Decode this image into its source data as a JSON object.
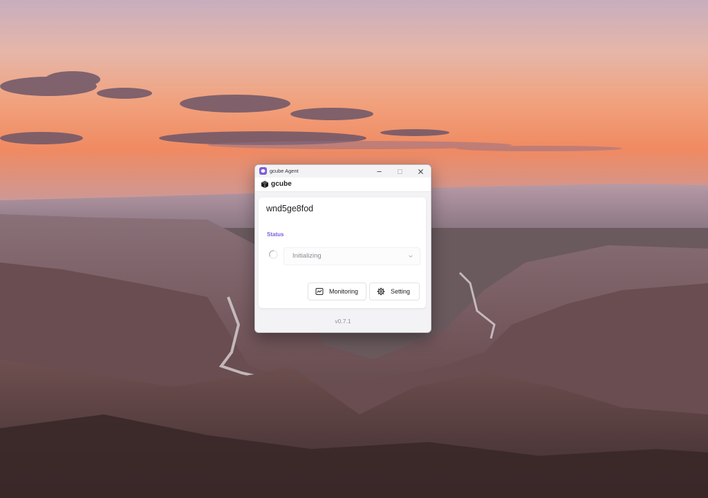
{
  "window": {
    "title": "gcube Agent",
    "brand": "gcube"
  },
  "agent": {
    "id": "wnd5ge8fod"
  },
  "status": {
    "label": "Status",
    "value": "Initializing"
  },
  "buttons": {
    "monitoring": "Monitoring",
    "setting": "Setting"
  },
  "footer": {
    "version": "v0.7.1"
  },
  "colors": {
    "accent": "#7b5ce0"
  },
  "icons": {
    "titlebar": [
      "app-icon",
      "minimize-icon",
      "maximize-icon",
      "close-icon"
    ],
    "brand": "cube-logo-icon",
    "status": [
      "spinner-icon",
      "chevron-down-icon"
    ],
    "buttons": [
      "monitoring-icon",
      "gear-icon"
    ]
  }
}
